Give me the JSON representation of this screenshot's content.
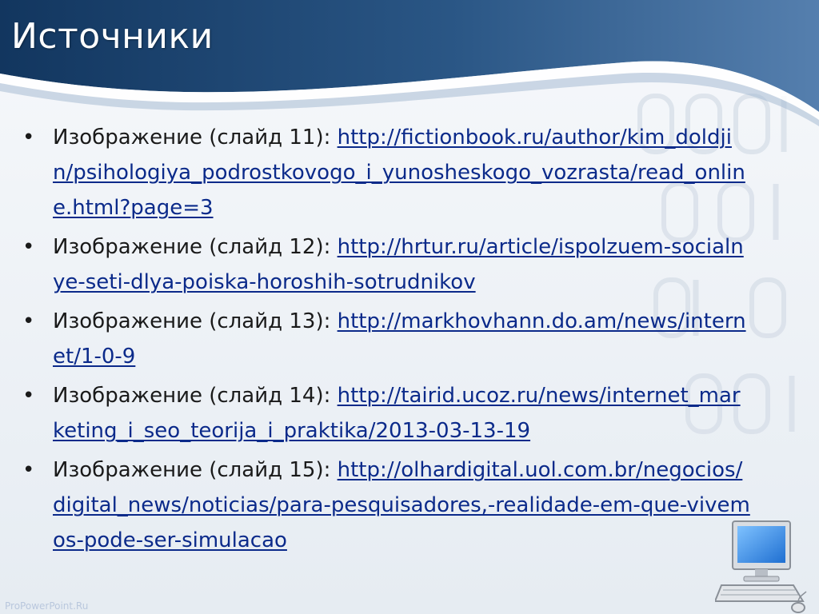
{
  "slide": {
    "title": "Источники",
    "watermark": "ProPowerPoint.Ru",
    "colors": {
      "header_dark": "#12365f",
      "header_mid": "#3f6a98",
      "text": "#1a1a1a",
      "link": "#0b2a8a"
    }
  },
  "sources": [
    {
      "bullet": "•",
      "label": "Изображение (слайд 11):",
      "url": "http://fictionbook.ru/author/kim_doldjin/psihologiya_podrostkovogo_i_yunosheskogo_vozrasta/read_online.html?page=3"
    },
    {
      "bullet": "•",
      "label": "Изображение (слайд 12):",
      "url": "http://hrtur.ru/article/ispolzuem-socialnye-seti-dlya-poiska-horoshih-sotrudnikov"
    },
    {
      "bullet": "•",
      "label": "Изображение (слайд 13):",
      "url": "http://markhovhann.do.am/news/internet/1-0-9"
    },
    {
      "bullet": "•",
      "label": "Изображение (слайд 14):",
      "url": "http://tairid.ucoz.ru/news/internet_marketing_i_seo_teorija_i_praktika/2013-03-13-19"
    },
    {
      "bullet": "•",
      "label": "Изображение (слайд 15):",
      "url": "http://olhardigital.uol.com.br/negocios/digital_news/noticias/para-pesquisadores,-realidade-em-que-vivemos-pode-ser-simulacao"
    }
  ],
  "icons": {
    "decoration": "computer-icon"
  }
}
